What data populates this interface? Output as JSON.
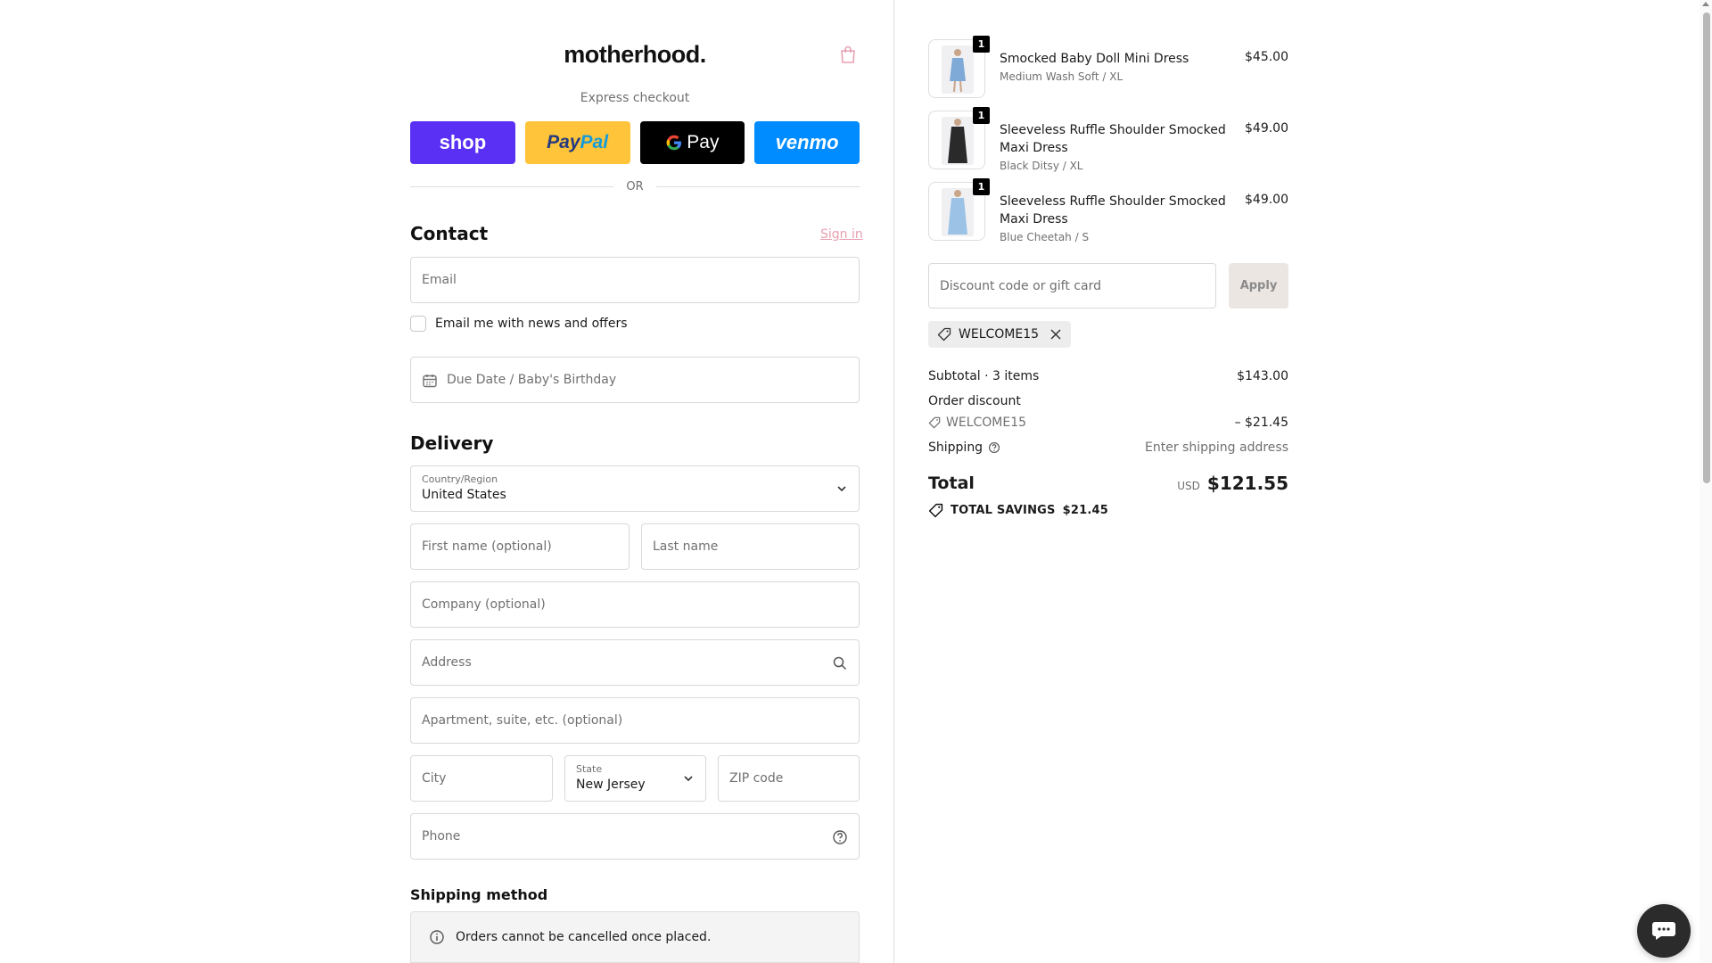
{
  "brand": {
    "logo_text": "motherhood."
  },
  "express": {
    "label": "Express checkout",
    "buttons": {
      "shop": "shop",
      "paypal_a": "Pay",
      "paypal_b": "Pal",
      "gpay": "Pay",
      "venmo": "venmo"
    }
  },
  "divider": {
    "or": "OR"
  },
  "contact": {
    "heading": "Contact",
    "signin": "Sign in",
    "email_placeholder": "Email",
    "newsletter_label": "Email me with news and offers",
    "due_date_placeholder": "Due Date / Baby's Birthday"
  },
  "delivery": {
    "heading": "Delivery",
    "country_label": "Country/Region",
    "country_value": "United States",
    "first_name_placeholder": "First name (optional)",
    "last_name_placeholder": "Last name",
    "company_placeholder": "Company (optional)",
    "address_placeholder": "Address",
    "apartment_placeholder": "Apartment, suite, etc. (optional)",
    "city_placeholder": "City",
    "state_label": "State",
    "state_value": "New Jersey",
    "zip_placeholder": "ZIP code",
    "phone_placeholder": "Phone"
  },
  "shipping_method": {
    "heading": "Shipping method",
    "notice": "Orders cannot be cancelled once placed."
  },
  "cart": {
    "items": [
      {
        "name": "Smocked Baby Doll Mini Dress",
        "variant": "Medium Wash Soft / XL",
        "price": "$45.00",
        "qty": "1",
        "color": "#7fa9d6"
      },
      {
        "name": "Sleeveless Ruffle Shoulder Smocked Maxi Dress",
        "variant": "Black Ditsy / XL",
        "price": "$49.00",
        "qty": "1",
        "color": "#2a2a2a"
      },
      {
        "name": "Sleeveless Ruffle Shoulder Smocked Maxi Dress",
        "variant": "Blue Cheetah / S",
        "price": "$49.00",
        "qty": "1",
        "color": "#9cc3e6"
      }
    ],
    "discount_placeholder": "Discount code or gift card",
    "apply_label": "Apply",
    "applied_code": "WELCOME15"
  },
  "summary": {
    "subtotal_label": "Subtotal · 3 items",
    "subtotal_value": "$143.00",
    "order_discount_label": "Order discount",
    "discount_code": "WELCOME15",
    "discount_value": "– $21.45",
    "shipping_label": "Shipping",
    "shipping_value": "Enter shipping address",
    "total_label": "Total",
    "currency": "USD",
    "total_value": "$121.55",
    "savings_label": "TOTAL SAVINGS",
    "savings_value": "$21.45"
  },
  "colors": {
    "shop": "#5a31f4",
    "paypal": "#ffc439",
    "gpay": "#000000",
    "venmo": "#008cff",
    "signin": "#e8a0b0"
  },
  "icons": [
    "bag-icon",
    "calendar-icon",
    "chevron-down-icon",
    "search-icon",
    "help-circle-icon",
    "info-icon",
    "tag-icon",
    "close-icon",
    "chat-icon"
  ]
}
